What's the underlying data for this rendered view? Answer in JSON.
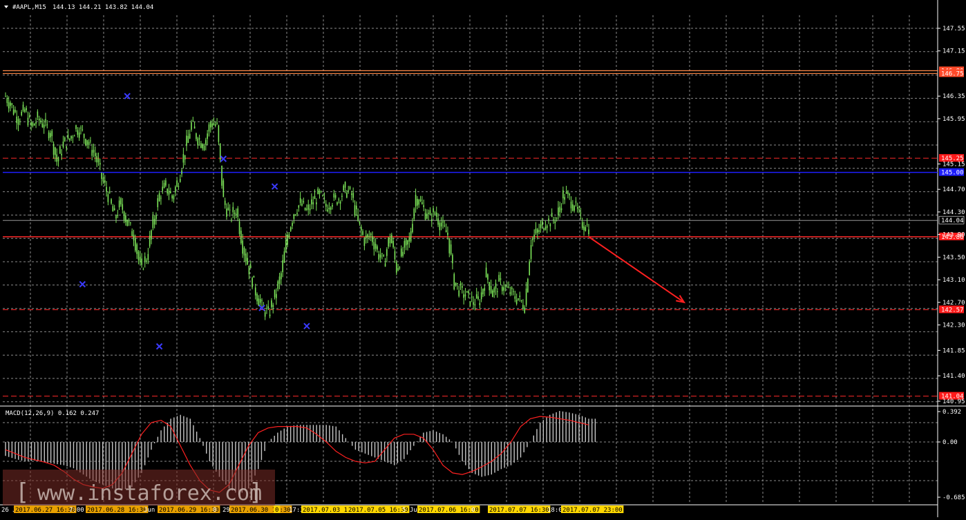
{
  "header": {
    "symbol": "#AAPL,M15",
    "prices": "144.13 144.21 143.82 144.04"
  },
  "macd": {
    "label": "MACD(12,26,9) 0.162 0.247",
    "ticks": [
      "0.392",
      "0.00",
      "-0.685"
    ]
  },
  "watermark": "www.instaforex.com",
  "colors": {
    "background": "#000000",
    "grid": "#8c8c8c",
    "candles": "#7ee85a",
    "support_resistance": "#ff2a2a",
    "pivot": "#1e1eff",
    "marker": "#3a3aff",
    "macd_hist": "#c8c8c8",
    "macd_signal": "#ff2020",
    "date_highlight": "#ffd700",
    "date_highlight_alt": "#e8a000"
  },
  "chart_data": {
    "type": "line",
    "ylim": [
      140.95,
      147.55
    ],
    "yticks": [
      "147.55",
      "147.15",
      "146.35",
      "145.95",
      "145.15",
      "144.70",
      "144.30",
      "143.90",
      "143.50",
      "143.10",
      "142.70",
      "142.30",
      "141.85",
      "141.40",
      "140.95"
    ],
    "current_price": "144.04",
    "levels": [
      {
        "value": 146.8,
        "label": "146.80",
        "style": "solid-orange"
      },
      {
        "value": 146.75,
        "label": "146.75",
        "style": "solid-orange"
      },
      {
        "value": 145.25,
        "label": "145.25",
        "style": "dashed"
      },
      {
        "value": 145.0,
        "label": "145.00",
        "style": "solid-blue"
      },
      {
        "value": 143.86,
        "label": "143.86",
        "style": "solid"
      },
      {
        "value": 142.57,
        "label": "142.57",
        "style": "dashed"
      },
      {
        "value": 141.04,
        "label": "141.04",
        "style": "dashed"
      }
    ],
    "series": [
      {
        "values": [
          146.35,
          146.15,
          145.95,
          146.1,
          145.8,
          145.95,
          145.85,
          145.7,
          145.2,
          145.5,
          145.6,
          145.8,
          145.7,
          145.5,
          145.3,
          144.9,
          144.6,
          144.2,
          144.45,
          144.1,
          143.9,
          143.3,
          143.5,
          144.1,
          144.6,
          144.75,
          144.55,
          144.9,
          145.4,
          145.85,
          145.6,
          145.5,
          145.9,
          145.8,
          144.5,
          144.2,
          144.35,
          143.7,
          143.3,
          142.9,
          142.6,
          142.5,
          142.8,
          143.2,
          143.9,
          144.3,
          144.45,
          144.3,
          144.5,
          144.6,
          144.4,
          144.5,
          144.55,
          144.7,
          144.6,
          144.1,
          143.8,
          143.9,
          143.6,
          143.4,
          143.9,
          143.3,
          143.6,
          143.8,
          144.6,
          144.4,
          144.2,
          144.3,
          144.05,
          143.9,
          143.05,
          142.9,
          142.8,
          142.7,
          142.75,
          143.2,
          142.85,
          143.05,
          142.95,
          142.85,
          142.75,
          142.65,
          143.8,
          143.95,
          144.1,
          144.15,
          144.2,
          144.6,
          144.55,
          144.35,
          144.1,
          144.04
        ]
      }
    ],
    "markers": [
      {
        "i": 12,
        "y": 143.02
      },
      {
        "i": 19,
        "y": 146.35
      },
      {
        "i": 24,
        "y": 141.92
      },
      {
        "i": 34,
        "y": 145.24
      },
      {
        "i": 40,
        "y": 142.6
      },
      {
        "i": 42,
        "y": 144.75
      },
      {
        "i": 47,
        "y": 142.28
      }
    ],
    "forecast": {
      "from": 143.86,
      "to": 142.7
    },
    "macd_hist": [
      -0.18,
      -0.22,
      -0.25,
      -0.24,
      -0.26,
      -0.28,
      -0.3,
      -0.34,
      -0.42,
      -0.5,
      -0.55,
      -0.6,
      -0.62,
      -0.58,
      -0.4,
      -0.1,
      0.15,
      0.3,
      0.35,
      0.3,
      0.05,
      -0.25,
      -0.45,
      -0.6,
      -0.68,
      -0.6,
      -0.35,
      0.0,
      0.12,
      0.2,
      0.22,
      0.22,
      0.22,
      0.22,
      0.2,
      0.05,
      -0.1,
      -0.15,
      -0.2,
      -0.25,
      -0.3,
      -0.22,
      -0.05,
      0.12,
      0.15,
      0.1,
      0.0,
      -0.25,
      -0.4,
      -0.45,
      -0.42,
      -0.35,
      -0.3,
      -0.2,
      0.0,
      0.25,
      0.35,
      0.4,
      0.38,
      0.35,
      0.3
    ],
    "macd_signal": [
      -0.1,
      -0.15,
      -0.2,
      -0.23,
      -0.26,
      -0.3,
      -0.38,
      -0.48,
      -0.55,
      -0.58,
      -0.6,
      -0.55,
      -0.4,
      -0.15,
      0.1,
      0.25,
      0.28,
      0.2,
      -0.05,
      -0.3,
      -0.5,
      -0.62,
      -0.65,
      -0.55,
      -0.3,
      -0.05,
      0.12,
      0.18,
      0.2,
      0.2,
      0.2,
      0.18,
      0.1,
      0.0,
      -0.12,
      -0.2,
      -0.25,
      -0.27,
      -0.25,
      -0.1,
      0.05,
      0.1,
      0.1,
      0.05,
      -0.1,
      -0.3,
      -0.4,
      -0.42,
      -0.38,
      -0.32,
      -0.25,
      -0.15,
      0.0,
      0.2,
      0.3,
      0.33,
      0.32,
      0.3,
      0.28,
      0.25,
      0.22
    ],
    "xticks": [
      {
        "label": "26 J",
        "hl": "none"
      },
      {
        "label": "2017.06.27 16:30",
        "hl": "orange"
      },
      {
        "label": "7:00",
        "hl": "none"
      },
      {
        "label": "2017.06.28 16:30",
        "hl": "orange"
      },
      {
        "label": "Jun",
        "hl": "none"
      },
      {
        "label": "2017.06.29 16:30",
        "hl": "orange"
      },
      {
        "label": "0",
        "hl": "none"
      },
      {
        "label": "29",
        "hl": "none"
      },
      {
        "label": "2017.06.30 16:30",
        "hl": "orange"
      },
      {
        "label": "0",
        "hl": "yellow"
      },
      {
        "label": "17:3",
        "hl": "none"
      },
      {
        "label": "2017.07.03 16",
        "hl": "yellow"
      },
      {
        "label": "2017.07.05 16:30",
        "hl": "yellow"
      },
      {
        "label": "5 Jul",
        "hl": "none"
      },
      {
        "label": "2017.07.06 16:30",
        "hl": "yellow"
      },
      {
        "label": "0",
        "hl": "none"
      },
      {
        "label": "2017.07.07 16:30",
        "hl": "yellow"
      },
      {
        "label": "18:0",
        "hl": "none"
      },
      {
        "label": "2017.07.07 23:00",
        "hl": "yellow"
      }
    ]
  }
}
